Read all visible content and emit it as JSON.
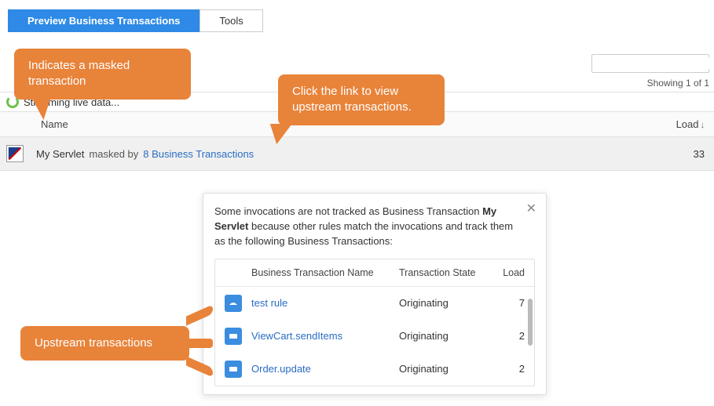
{
  "tabs": {
    "preview": "Preview Business Transactions",
    "tools": "Tools"
  },
  "search": {
    "placeholder": ""
  },
  "showing_text": "Showing 1 of 1",
  "streaming_text": "Streaming live data...",
  "table": {
    "headers": {
      "name": "Name",
      "load": "Load"
    },
    "row": {
      "name": "My Servlet",
      "masked_by_label": "masked by",
      "link": "8 Business Transactions",
      "load": "33"
    }
  },
  "popover": {
    "desc_prefix": "Some invocations are not tracked as Business Transaction ",
    "bt_name": "My Servlet",
    "desc_suffix": " because other rules match the invocations and track them as the following Business Transactions:",
    "headers": {
      "name": "Business Transaction Name",
      "state": "Transaction State",
      "load": "Load"
    },
    "rows": [
      {
        "name": "test rule",
        "state": "Originating",
        "load": "7"
      },
      {
        "name": "ViewCart.sendItems",
        "state": "Originating",
        "load": "2"
      },
      {
        "name": "Order.update",
        "state": "Originating",
        "load": "2"
      }
    ]
  },
  "callouts": {
    "c1": "Indicates a masked transaction",
    "c2": "Click the link to view upstream transactions.",
    "c3": "Upstream transactions"
  }
}
